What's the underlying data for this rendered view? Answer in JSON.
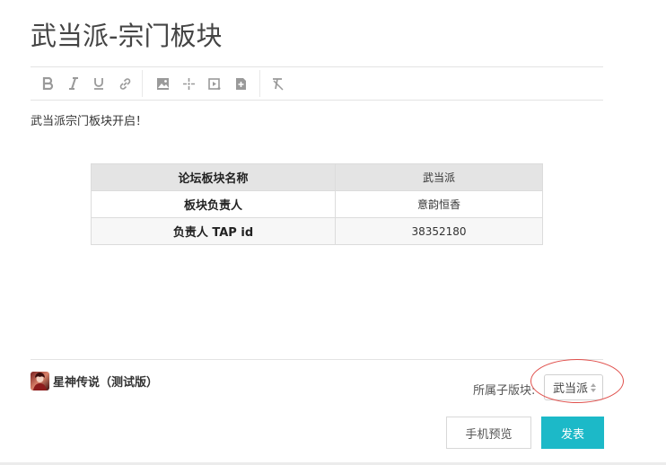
{
  "page": {
    "title": "武当派-宗门板块"
  },
  "toolbar": {
    "buttons": [
      "bold-icon",
      "italic-icon",
      "underline-icon",
      "link-icon",
      "image-icon",
      "move-icon",
      "video-icon",
      "add-file-icon",
      "clear-format-icon"
    ]
  },
  "content": {
    "paragraph": "武当派宗门板块开启！",
    "table": [
      {
        "key": "论坛板块名称",
        "value": "武当派"
      },
      {
        "key": "板块负责人",
        "value": "意韵恒香"
      },
      {
        "key": "负责人 TAP id",
        "value": "38352180"
      }
    ]
  },
  "footer": {
    "game_name": "星神传说（测试版）",
    "sub_section_label": "所属子版块:",
    "sub_section_value": "武当派",
    "preview_label": "手机预览",
    "publish_label": "发表",
    "accent_color": "#1cb9c8",
    "highlight_circle_color": "#e0504c"
  }
}
